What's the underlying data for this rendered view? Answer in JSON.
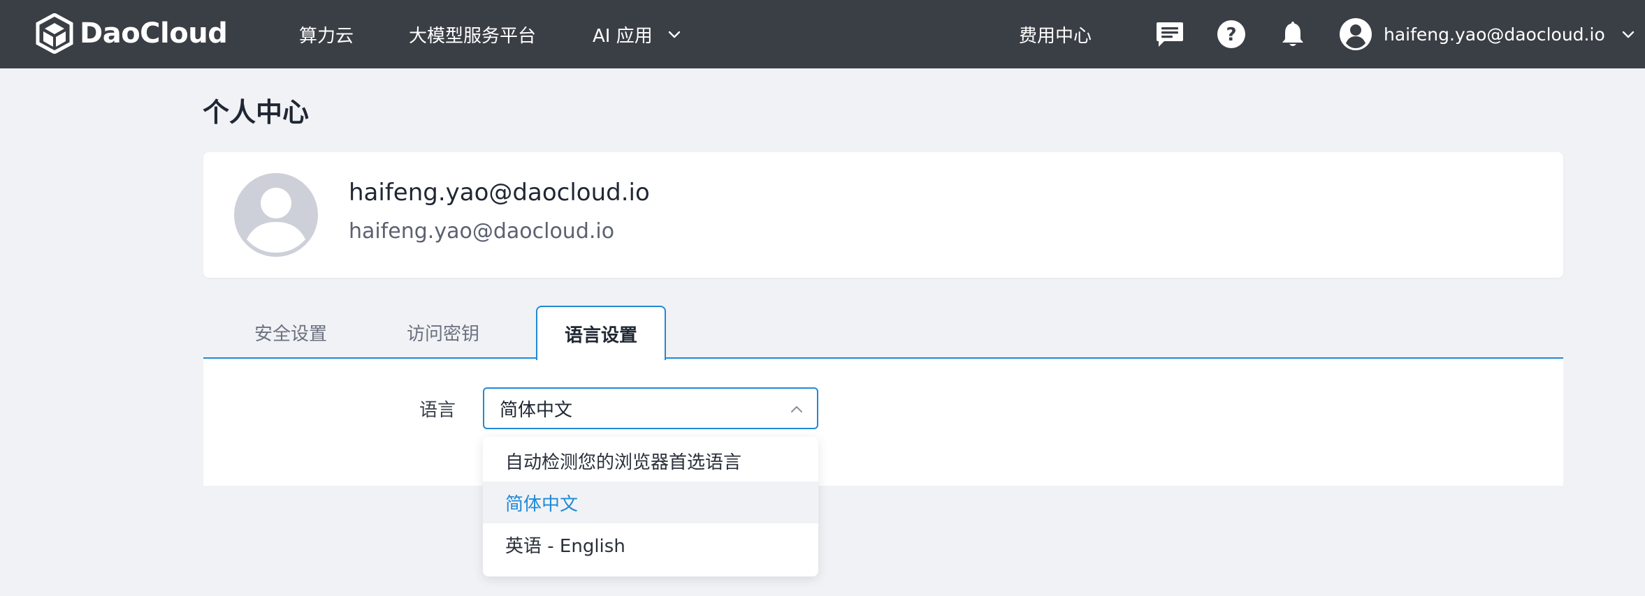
{
  "topbar": {
    "brand": "DaoCloud",
    "nav": [
      {
        "label": "算力云"
      },
      {
        "label": "大模型服务平台"
      },
      {
        "label": "AI 应用"
      }
    ],
    "billing_label": "费用中心",
    "user_email": "haifeng.yao@daocloud.io",
    "icons": [
      "message-icon",
      "help-icon",
      "bell-icon",
      "user-avatar-icon",
      "chevron-down-icon"
    ]
  },
  "page": {
    "title": "个人中心",
    "profile": {
      "name": "haifeng.yao@daocloud.io",
      "email": "haifeng.yao@daocloud.io"
    },
    "tabs": [
      {
        "label": "安全设置",
        "active": false
      },
      {
        "label": "访问密钥",
        "active": false
      },
      {
        "label": "语言设置",
        "active": true
      }
    ],
    "language": {
      "label": "语言",
      "selected": "简体中文",
      "options": [
        {
          "label": "自动检测您的浏览器首选语言",
          "selected": false
        },
        {
          "label": "简体中文",
          "selected": true
        },
        {
          "label": "英语 - English",
          "selected": false
        }
      ]
    }
  },
  "colors": {
    "topbar_bg": "#3a3e45",
    "page_bg": "#f1f2f5",
    "accent": "#1f8ad8",
    "avatar_gray": "#cdd0d8"
  }
}
